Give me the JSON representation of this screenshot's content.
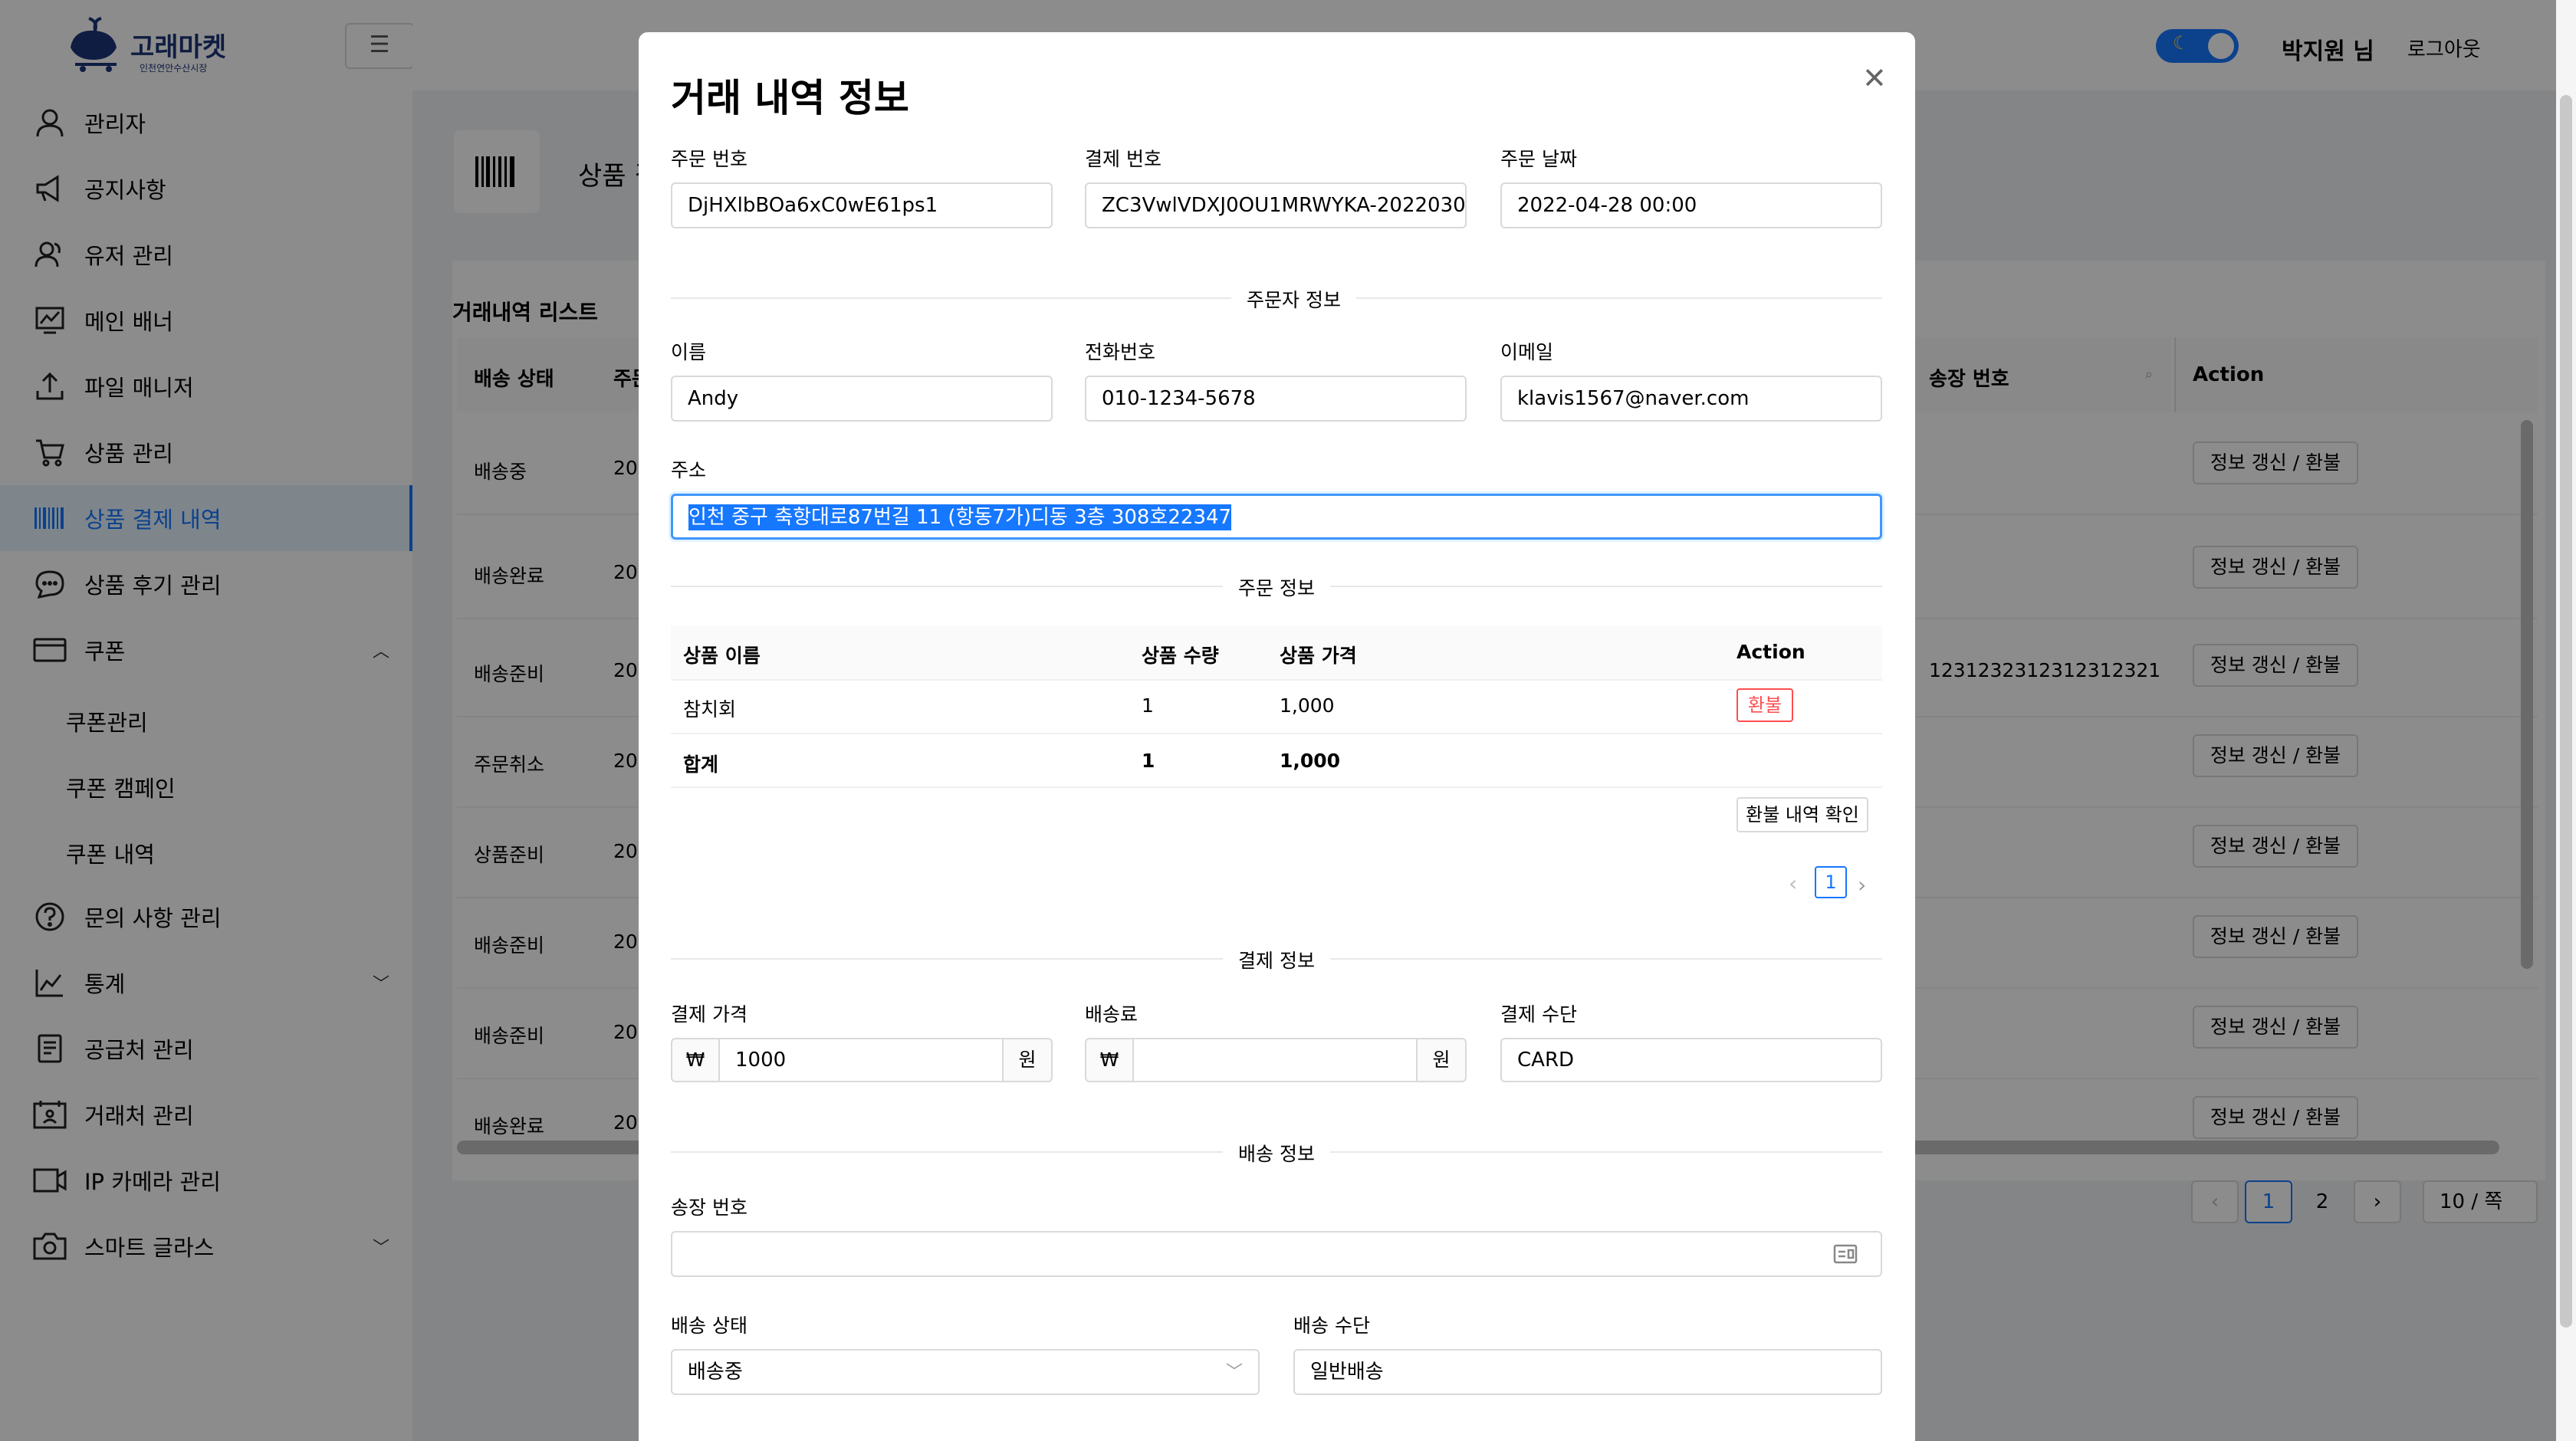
{
  "app": {
    "logo_text": "고래마켓",
    "logo_sub": "인천연안수산시장"
  },
  "topbar": {
    "username": "박지원 님",
    "logout": "로그아웃"
  },
  "sidebar": {
    "items": [
      {
        "label": "관리자",
        "icon": "user-icon"
      },
      {
        "label": "공지사항",
        "icon": "megaphone-icon"
      },
      {
        "label": "유저 관리",
        "icon": "users-icon"
      },
      {
        "label": "메인 배너",
        "icon": "chart-screen-icon"
      },
      {
        "label": "파일 매니저",
        "icon": "upload-icon"
      },
      {
        "label": "상품 관리",
        "icon": "cart-icon"
      },
      {
        "label": "상품 결제 내역",
        "icon": "barcode-icon"
      },
      {
        "label": "상품 후기 관리",
        "icon": "chat-icon"
      },
      {
        "label": "쿠폰",
        "icon": "card-icon"
      },
      {
        "label": "문의 사항 관리",
        "icon": "question-icon"
      },
      {
        "label": "통계",
        "icon": "line-chart-icon"
      },
      {
        "label": "공급처 관리",
        "icon": "document-icon"
      },
      {
        "label": "거래처 관리",
        "icon": "calendar-user-icon"
      },
      {
        "label": "IP 카메라 관리",
        "icon": "video-icon"
      },
      {
        "label": "스마트 글라스",
        "icon": "camera-icon"
      }
    ],
    "coupon_sub": [
      "쿠폰관리",
      "쿠폰 캠페인",
      "쿠폰 내역"
    ]
  },
  "page": {
    "title": "상품 결제 내역",
    "list_title": "거래내역 리스트"
  },
  "list": {
    "col_status": "배송 상태",
    "col_order": "주문",
    "col_invoice": "송장 번호",
    "col_action": "Action",
    "action_label": "정보 갱신 / 환불",
    "rows": [
      {
        "status": "배송중",
        "date": "20",
        "invoice": ""
      },
      {
        "status": "배송완료",
        "date": "20",
        "invoice": ""
      },
      {
        "status": "배송준비",
        "date": "20",
        "invoice": "1231232312312312321"
      },
      {
        "status": "주문취소",
        "date": "20",
        "invoice": ""
      },
      {
        "status": "상품준비",
        "date": "20",
        "invoice": ""
      },
      {
        "status": "배송준비",
        "date": "20",
        "invoice": ""
      },
      {
        "status": "배송준비",
        "date": "20",
        "invoice": ""
      },
      {
        "status": "배송완료",
        "date": "20",
        "invoice": ""
      }
    ],
    "pages": [
      "1",
      "2"
    ],
    "page_size": "10 / 쪽"
  },
  "modal": {
    "title": "거래 내역 정보",
    "order_no_label": "주문 번호",
    "order_no": "DjHXlbBOa6xC0wE61ps1",
    "pay_no_label": "결제 번호",
    "pay_no": "ZC3VwlVDXJ0OU1MRWYKA-2022030",
    "order_date_label": "주문 날짜",
    "order_date": "2022-04-28 00:00",
    "section_orderer": "주문자 정보",
    "name_label": "이름",
    "name": "Andy",
    "phone_label": "전화번호",
    "phone": "010-1234-5678",
    "email_label": "이메일",
    "email": "klavis1567@naver.com",
    "address_label": "주소",
    "address": "인천 중구 축항대로87번길 11 (항동7가)디동 3층 308호22347",
    "section_order": "주문 정보",
    "table": {
      "headers": [
        "상품 이름",
        "상품 수량",
        "상품 가격",
        "Action"
      ],
      "row": {
        "name": "참치회",
        "qty": "1",
        "price": "1,000",
        "action": "환불"
      },
      "total": {
        "name": "합계",
        "qty": "1",
        "price": "1,000"
      }
    },
    "refund_history": "환불 내역 확인",
    "page": "1",
    "section_payment": "결제 정보",
    "pay_price_label": "결제 가격",
    "pay_price": "1000",
    "currency": "₩",
    "won": "원",
    "shipping_fee_label": "배송료",
    "shipping_fee": "",
    "pay_method_label": "결제 수단",
    "pay_method": "CARD",
    "section_delivery": "배송 정보",
    "invoice_label": "송장 번호",
    "invoice": "",
    "delivery_status_label": "배송 상태",
    "delivery_status": "배송중",
    "delivery_method_label": "배송 수단",
    "delivery_method": "일반배송"
  },
  "colors": {
    "accent": "#1677ff",
    "danger": "#ff4d4f",
    "brand": "#1c3578"
  }
}
